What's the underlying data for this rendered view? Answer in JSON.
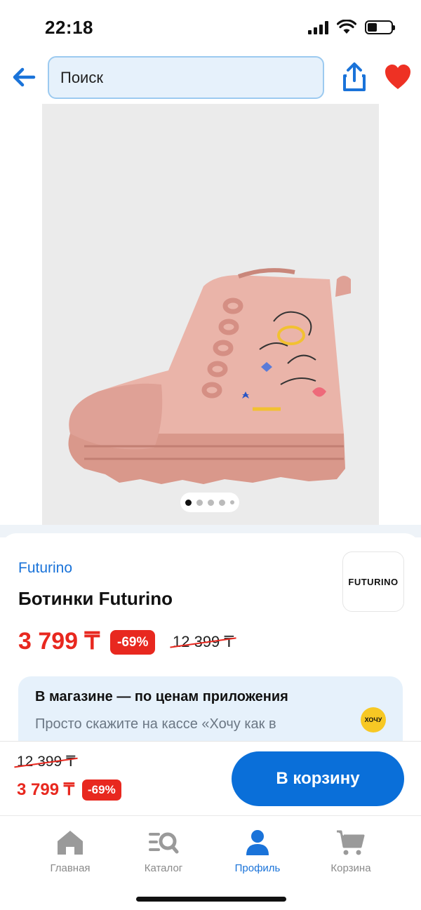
{
  "status_bar": {
    "time": "22:18",
    "battery_level": 0.4
  },
  "header": {
    "search_placeholder": "Поиск"
  },
  "gallery": {
    "image_count": 5,
    "active_index": 0
  },
  "product": {
    "brand": "Futurino",
    "brand_logo_text": "FUTURINO",
    "title": "Ботинки Futurino",
    "price": "3 799 ₸",
    "discount": "-69%",
    "old_price": "12 399 ₸"
  },
  "promo": {
    "title": "В магазине — по ценам приложения",
    "text": "Просто скажите на кассе «Хочу как в приложении»",
    "badge": "ХОЧУ"
  },
  "buy_bar": {
    "old_price": "12 399 ₸",
    "price": "3 799 ₸",
    "discount": "-69%",
    "button_label": "В корзину"
  },
  "tabs": [
    {
      "label": "Главная",
      "icon": "home-icon",
      "active": false
    },
    {
      "label": "Каталог",
      "icon": "catalog-icon",
      "active": false
    },
    {
      "label": "Профиль",
      "icon": "profile-icon",
      "active": true
    },
    {
      "label": "Корзина",
      "icon": "cart-icon",
      "active": false
    }
  ],
  "colors": {
    "accent": "#1a73d9",
    "button": "#0a6fd9",
    "sale": "#e8281f",
    "favorite": "#ee3124",
    "boot": "#e8b1a6"
  }
}
